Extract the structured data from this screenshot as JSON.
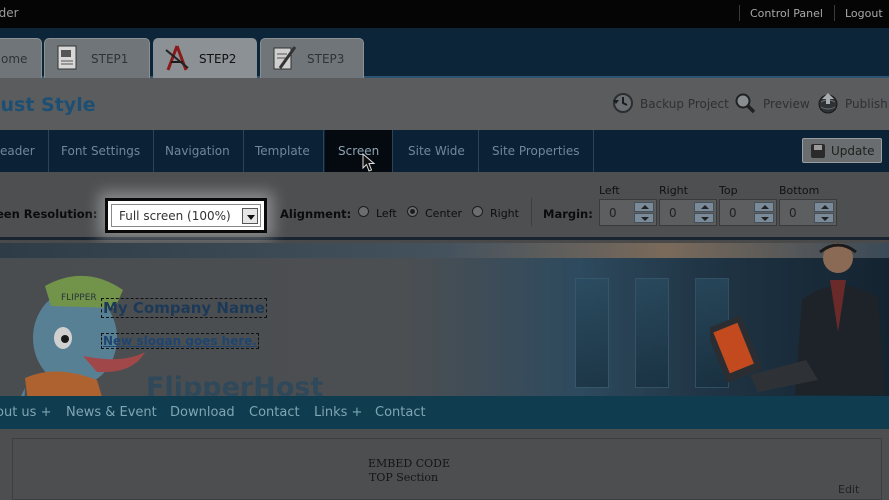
{
  "app": {
    "title_fragment": "ilder"
  },
  "top_links": {
    "control_panel": "Control Panel",
    "logout": "Logout"
  },
  "steps": [
    {
      "label": "ome",
      "partial": true
    },
    {
      "label": "STEP1"
    },
    {
      "label": "STEP2",
      "active": true
    },
    {
      "label": "STEP3"
    }
  ],
  "page": {
    "title": "just Style"
  },
  "toolbar": {
    "backup": "Backup Project",
    "preview": "Preview",
    "publish": "Publish"
  },
  "nav_tabs": [
    "eader",
    "Font Settings",
    "Navigation",
    "Template",
    "Screen",
    "Site Wide",
    "Site Properties"
  ],
  "nav_active": "Screen",
  "update_button": "Update",
  "settings": {
    "resolution_label": "een Resolution:",
    "resolution_value": "Full screen (100%)",
    "alignment_label": "Alignment:",
    "alignment_options": [
      "Left",
      "Center",
      "Right"
    ],
    "alignment_selected": "Center",
    "margin_label": "Margin:",
    "margins": [
      {
        "label": "Left",
        "value": "0"
      },
      {
        "label": "Right",
        "value": "0"
      },
      {
        "label": "Top",
        "value": "0"
      },
      {
        "label": "Bottom",
        "value": "0"
      }
    ]
  },
  "preview": {
    "company_name": "My Company Name",
    "slogan": "New slogan goes here.",
    "brand": "FlipperHost",
    "mascot_cap": "FLIPPER",
    "menu": [
      "out us +",
      "News & Event",
      "Download",
      "Contact",
      "Links +",
      "Contact"
    ],
    "embed_line1": "EMBED CODE",
    "embed_line2": "TOP Section",
    "edit": "Edit"
  },
  "colors": {
    "title_blue": "#1c4f73",
    "nav_bg": "#0b2236",
    "menu_bar": "#0f3c4e"
  }
}
